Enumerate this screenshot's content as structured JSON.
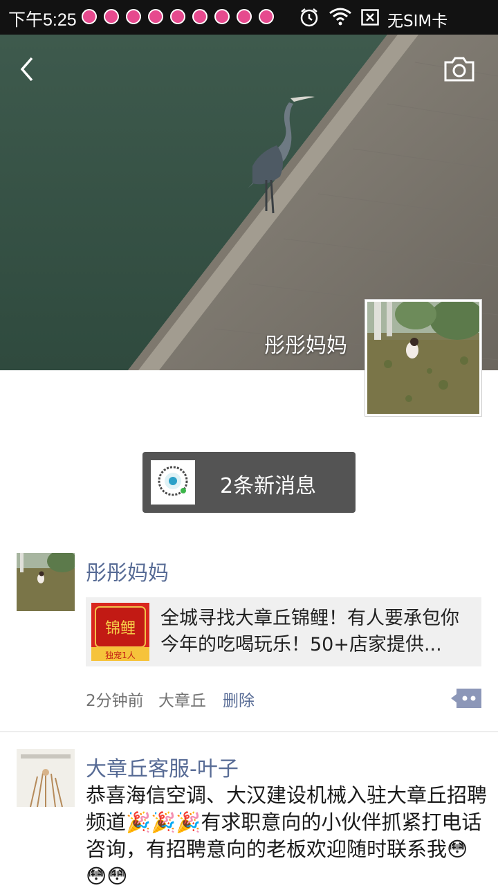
{
  "status_bar": {
    "time": "下午5:25",
    "carrier": "无SIM卡",
    "icons": [
      "notification-icon",
      "notification-icon",
      "notification-icon",
      "notification-icon",
      "notification-icon",
      "notification-icon",
      "notification-icon",
      "notification-icon",
      "notification-icon",
      "alarm-icon",
      "wifi-icon",
      "no-sim-icon"
    ]
  },
  "header": {
    "back_icon": "back-arrow-icon",
    "camera_icon": "camera-icon",
    "profile_name": "彤彤妈妈"
  },
  "new_messages": {
    "label": "2条新消息"
  },
  "posts": [
    {
      "author": "彤彤妈妈",
      "link_card": {
        "title": "全城寻找大章丘锦鲤！有人要承包你今年的吃喝玩乐！50+店家提供...",
        "thumb_text": "锦鲤",
        "thumb_sub": "独宠1人"
      },
      "time": "2分钟前",
      "location": "大章丘",
      "delete_label": "删除"
    },
    {
      "author": "大章丘客服-叶子",
      "text": "恭喜海信空调、大汉建设机械入驻大章丘招聘频道🎉🎉🎉有求职意向的小伙伴抓紧打电话咨询，有招聘意向的老板欢迎随时联系我😳😳😳"
    }
  ],
  "colors": {
    "link_blue": "#576b95",
    "status_bar": "#121212",
    "toast_bg": "#545454"
  }
}
